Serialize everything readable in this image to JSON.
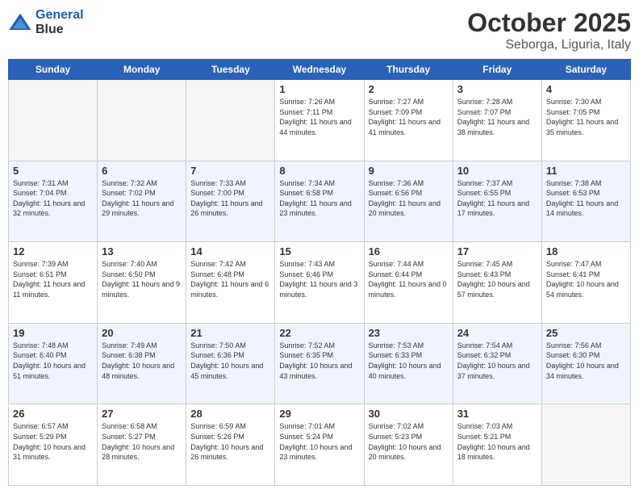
{
  "header": {
    "logo_line1": "General",
    "logo_line2": "Blue",
    "title": "October 2025",
    "subtitle": "Seborga, Liguria, Italy"
  },
  "days_of_week": [
    "Sunday",
    "Monday",
    "Tuesday",
    "Wednesday",
    "Thursday",
    "Friday",
    "Saturday"
  ],
  "weeks": [
    [
      {
        "day": "",
        "sunrise": "",
        "sunset": "",
        "daylight": ""
      },
      {
        "day": "",
        "sunrise": "",
        "sunset": "",
        "daylight": ""
      },
      {
        "day": "",
        "sunrise": "",
        "sunset": "",
        "daylight": ""
      },
      {
        "day": "1",
        "sunrise": "Sunrise: 7:26 AM",
        "sunset": "Sunset: 7:11 PM",
        "daylight": "Daylight: 11 hours and 44 minutes."
      },
      {
        "day": "2",
        "sunrise": "Sunrise: 7:27 AM",
        "sunset": "Sunset: 7:09 PM",
        "daylight": "Daylight: 11 hours and 41 minutes."
      },
      {
        "day": "3",
        "sunrise": "Sunrise: 7:28 AM",
        "sunset": "Sunset: 7:07 PM",
        "daylight": "Daylight: 11 hours and 38 minutes."
      },
      {
        "day": "4",
        "sunrise": "Sunrise: 7:30 AM",
        "sunset": "Sunset: 7:05 PM",
        "daylight": "Daylight: 11 hours and 35 minutes."
      }
    ],
    [
      {
        "day": "5",
        "sunrise": "Sunrise: 7:31 AM",
        "sunset": "Sunset: 7:04 PM",
        "daylight": "Daylight: 11 hours and 32 minutes."
      },
      {
        "day": "6",
        "sunrise": "Sunrise: 7:32 AM",
        "sunset": "Sunset: 7:02 PM",
        "daylight": "Daylight: 11 hours and 29 minutes."
      },
      {
        "day": "7",
        "sunrise": "Sunrise: 7:33 AM",
        "sunset": "Sunset: 7:00 PM",
        "daylight": "Daylight: 11 hours and 26 minutes."
      },
      {
        "day": "8",
        "sunrise": "Sunrise: 7:34 AM",
        "sunset": "Sunset: 6:58 PM",
        "daylight": "Daylight: 11 hours and 23 minutes."
      },
      {
        "day": "9",
        "sunrise": "Sunrise: 7:36 AM",
        "sunset": "Sunset: 6:56 PM",
        "daylight": "Daylight: 11 hours and 20 minutes."
      },
      {
        "day": "10",
        "sunrise": "Sunrise: 7:37 AM",
        "sunset": "Sunset: 6:55 PM",
        "daylight": "Daylight: 11 hours and 17 minutes."
      },
      {
        "day": "11",
        "sunrise": "Sunrise: 7:38 AM",
        "sunset": "Sunset: 6:53 PM",
        "daylight": "Daylight: 11 hours and 14 minutes."
      }
    ],
    [
      {
        "day": "12",
        "sunrise": "Sunrise: 7:39 AM",
        "sunset": "Sunset: 6:51 PM",
        "daylight": "Daylight: 11 hours and 11 minutes."
      },
      {
        "day": "13",
        "sunrise": "Sunrise: 7:40 AM",
        "sunset": "Sunset: 6:50 PM",
        "daylight": "Daylight: 11 hours and 9 minutes."
      },
      {
        "day": "14",
        "sunrise": "Sunrise: 7:42 AM",
        "sunset": "Sunset: 6:48 PM",
        "daylight": "Daylight: 11 hours and 6 minutes."
      },
      {
        "day": "15",
        "sunrise": "Sunrise: 7:43 AM",
        "sunset": "Sunset: 6:46 PM",
        "daylight": "Daylight: 11 hours and 3 minutes."
      },
      {
        "day": "16",
        "sunrise": "Sunrise: 7:44 AM",
        "sunset": "Sunset: 6:44 PM",
        "daylight": "Daylight: 11 hours and 0 minutes."
      },
      {
        "day": "17",
        "sunrise": "Sunrise: 7:45 AM",
        "sunset": "Sunset: 6:43 PM",
        "daylight": "Daylight: 10 hours and 57 minutes."
      },
      {
        "day": "18",
        "sunrise": "Sunrise: 7:47 AM",
        "sunset": "Sunset: 6:41 PM",
        "daylight": "Daylight: 10 hours and 54 minutes."
      }
    ],
    [
      {
        "day": "19",
        "sunrise": "Sunrise: 7:48 AM",
        "sunset": "Sunset: 6:40 PM",
        "daylight": "Daylight: 10 hours and 51 minutes."
      },
      {
        "day": "20",
        "sunrise": "Sunrise: 7:49 AM",
        "sunset": "Sunset: 6:38 PM",
        "daylight": "Daylight: 10 hours and 48 minutes."
      },
      {
        "day": "21",
        "sunrise": "Sunrise: 7:50 AM",
        "sunset": "Sunset: 6:36 PM",
        "daylight": "Daylight: 10 hours and 45 minutes."
      },
      {
        "day": "22",
        "sunrise": "Sunrise: 7:52 AM",
        "sunset": "Sunset: 6:35 PM",
        "daylight": "Daylight: 10 hours and 43 minutes."
      },
      {
        "day": "23",
        "sunrise": "Sunrise: 7:53 AM",
        "sunset": "Sunset: 6:33 PM",
        "daylight": "Daylight: 10 hours and 40 minutes."
      },
      {
        "day": "24",
        "sunrise": "Sunrise: 7:54 AM",
        "sunset": "Sunset: 6:32 PM",
        "daylight": "Daylight: 10 hours and 37 minutes."
      },
      {
        "day": "25",
        "sunrise": "Sunrise: 7:56 AM",
        "sunset": "Sunset: 6:30 PM",
        "daylight": "Daylight: 10 hours and 34 minutes."
      }
    ],
    [
      {
        "day": "26",
        "sunrise": "Sunrise: 6:57 AM",
        "sunset": "Sunset: 5:29 PM",
        "daylight": "Daylight: 10 hours and 31 minutes."
      },
      {
        "day": "27",
        "sunrise": "Sunrise: 6:58 AM",
        "sunset": "Sunset: 5:27 PM",
        "daylight": "Daylight: 10 hours and 28 minutes."
      },
      {
        "day": "28",
        "sunrise": "Sunrise: 6:59 AM",
        "sunset": "Sunset: 5:26 PM",
        "daylight": "Daylight: 10 hours and 26 minutes."
      },
      {
        "day": "29",
        "sunrise": "Sunrise: 7:01 AM",
        "sunset": "Sunset: 5:24 PM",
        "daylight": "Daylight: 10 hours and 23 minutes."
      },
      {
        "day": "30",
        "sunrise": "Sunrise: 7:02 AM",
        "sunset": "Sunset: 5:23 PM",
        "daylight": "Daylight: 10 hours and 20 minutes."
      },
      {
        "day": "31",
        "sunrise": "Sunrise: 7:03 AM",
        "sunset": "Sunset: 5:21 PM",
        "daylight": "Daylight: 10 hours and 18 minutes."
      },
      {
        "day": "",
        "sunrise": "",
        "sunset": "",
        "daylight": ""
      }
    ]
  ]
}
